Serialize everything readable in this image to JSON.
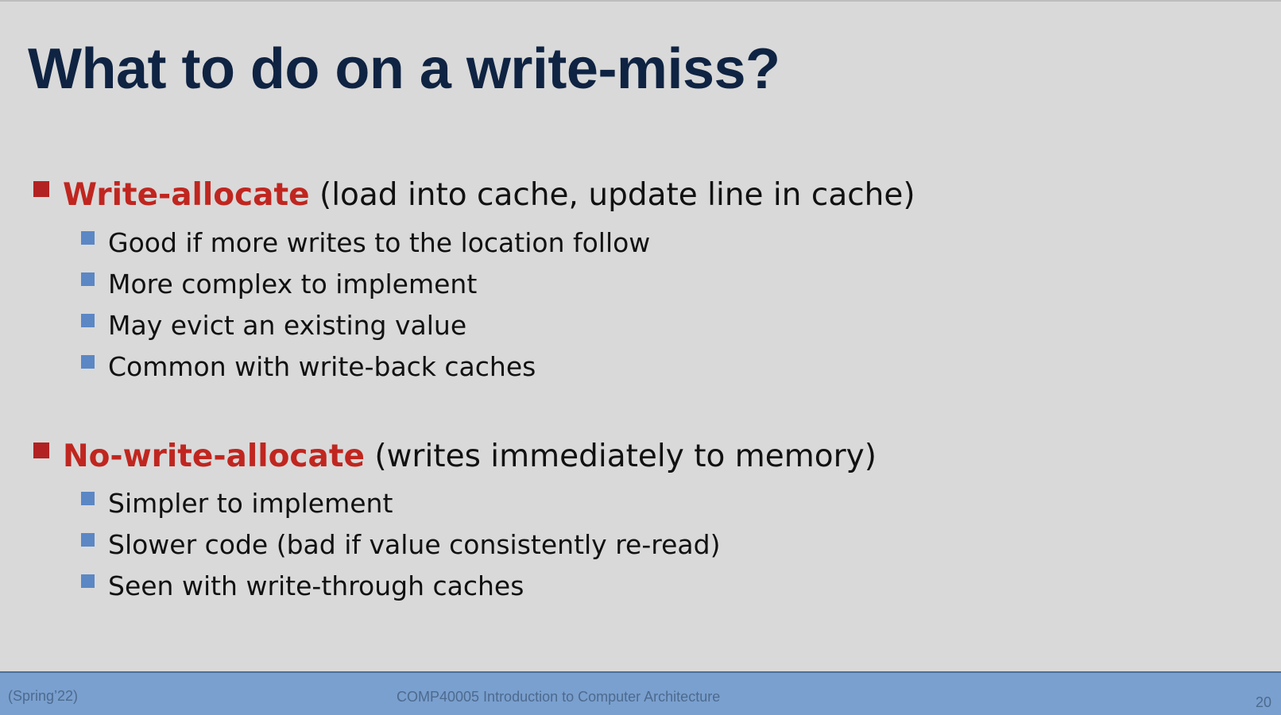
{
  "slide": {
    "title": "What to do on a write-miss?",
    "sections": [
      {
        "keyword": "Write-allocate",
        "description": " (load into cache, update line in cache)",
        "points": [
          "Good if more writes to the location follow",
          "More complex to implement",
          "May evict an existing value",
          "Common with write-back caches"
        ]
      },
      {
        "keyword": "No-write-allocate",
        "description": " (writes immediately to memory)",
        "points": [
          "Simpler to implement",
          "Slower code (bad if value consistently re-read)",
          "Seen with write-through caches"
        ]
      }
    ]
  },
  "footer": {
    "term": "(Spring’22)",
    "course": "COMP40005 Introduction to Computer Architecture",
    "page_number": "20"
  },
  "colors": {
    "background": "#d9d9d9",
    "title": "#0f2342",
    "keyword": "#c0261f",
    "level1_bullet": "#b22222",
    "level2_bullet": "#5b87c5",
    "footer_bar": "#7aa0cf"
  }
}
